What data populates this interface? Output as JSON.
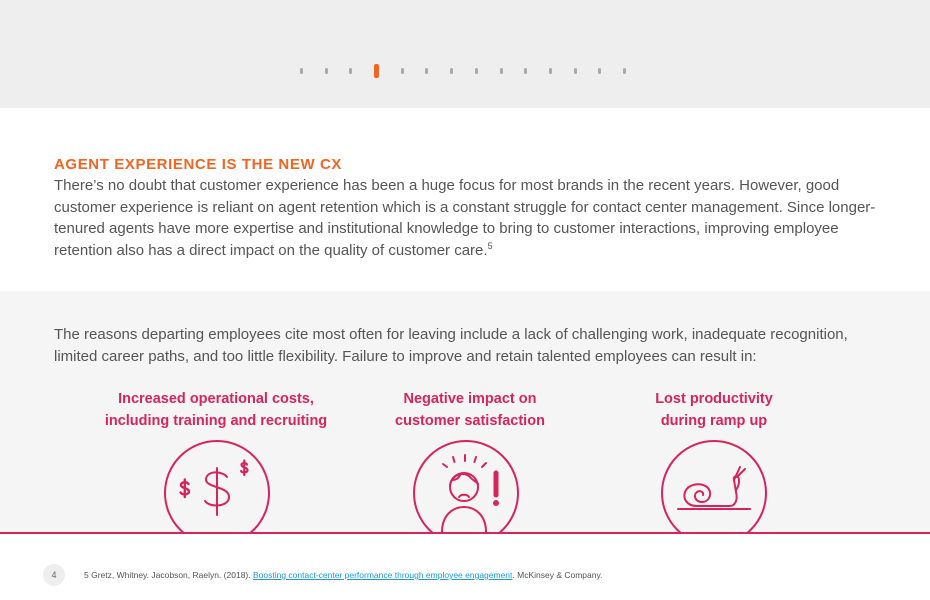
{
  "pager": {
    "total": 14,
    "active_index": 3,
    "active_color": "#f26522",
    "inactive_color": "#a9a9a9"
  },
  "section1": {
    "heading": "AGENT EXPERIENCE IS THE NEW CX",
    "heading_color": "#f26522",
    "body": "There’s no doubt that customer experience has been a huge focus for most brands in the recent years. However, good customer experience is reliant on agent retention which is a constant struggle for contact center management. Since longer-tenured agents have more expertise and institutional knowledge to bring to customer interactions, improving employee retention also has a direct impact on the quality of customer care.",
    "footnote_ref": "5"
  },
  "section2": {
    "body": "The reasons departing employees cite most often for leaving include a lack of challenging work, inadequate recognition, limited career paths, and too little flexibility. Failure to improve and retain talented employees can result in:",
    "accent_color": "#d6245c",
    "impacts": [
      {
        "line1": "Increased operational costs,",
        "line2": "including training and recruiting",
        "icon": "dollar-signs-icon"
      },
      {
        "line1": "Negative impact on",
        "line2": "customer satisfaction",
        "icon": "stressed-person-icon"
      },
      {
        "line1": "Lost productivity",
        "line2": "during ramp up",
        "icon": "snail-icon"
      }
    ]
  },
  "footer": {
    "page_number": "4",
    "footnote_prefix": "5 Gretz, Whitney. Jacobson, Raelyn. (2018). ",
    "footnote_link": "Boosting contact-center performance through employee engagement",
    "footnote_suffix": ". McKinsey & Company.",
    "link_color": "#1a9ad6"
  }
}
